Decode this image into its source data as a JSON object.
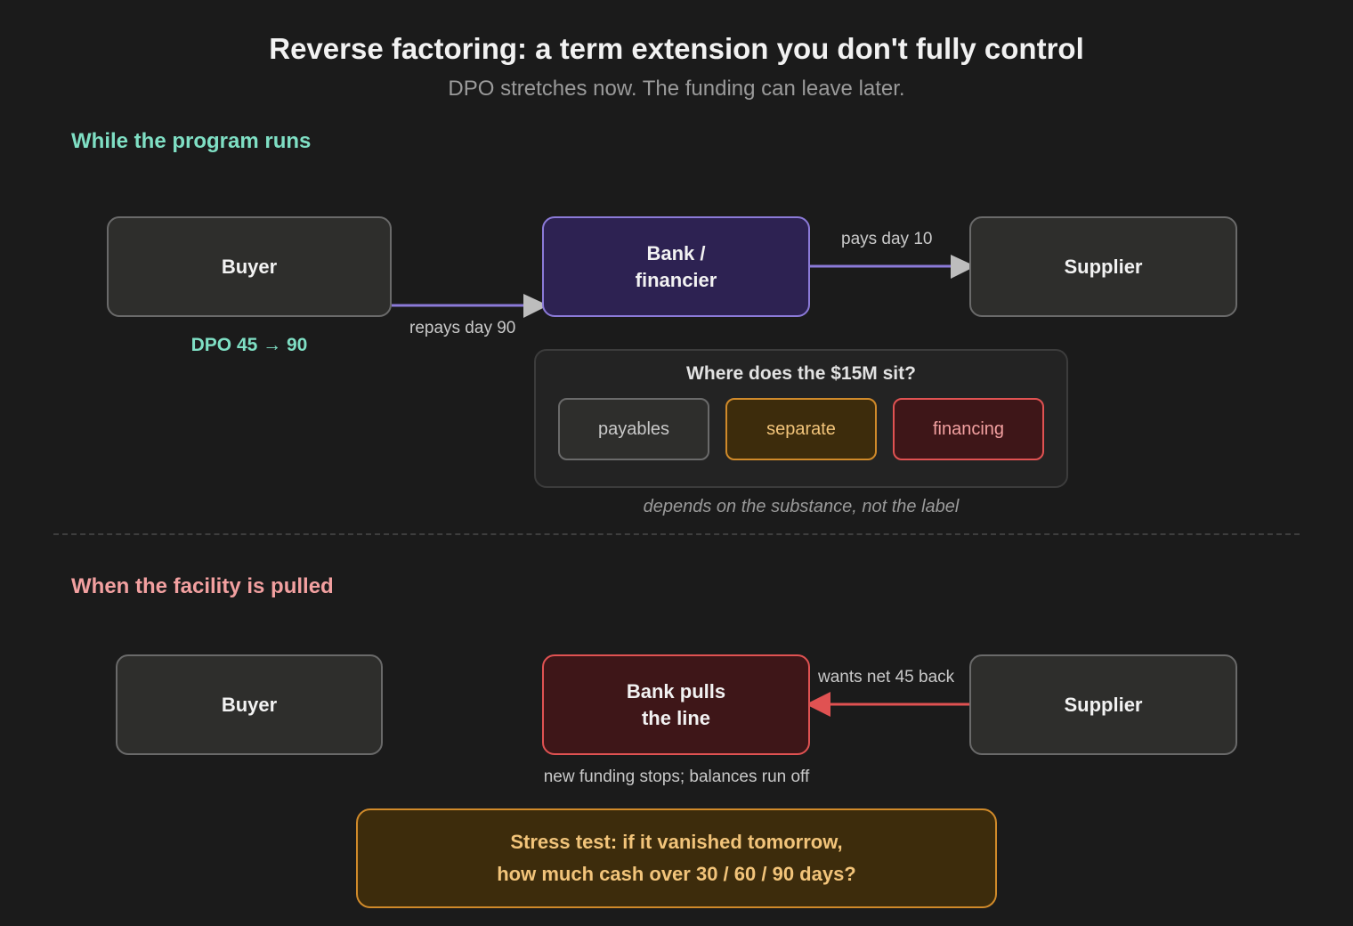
{
  "header": {
    "title": "Reverse factoring: a term extension you don't fully control",
    "subtitle": "DPO stretches now. The funding can leave later."
  },
  "running": {
    "heading": "While the program runs",
    "buyer": "Buyer",
    "bank_line1": "Bank /",
    "bank_line2": "financier",
    "supplier": "Supplier",
    "repays_label": "repays day 90",
    "pays_label": "pays day 10",
    "dpo_label": "DPO 45 → 90",
    "question": "Where does the $15M sit?",
    "options": [
      "payables",
      "separate",
      "financing"
    ],
    "note": "depends on the substance, not the label"
  },
  "pulled": {
    "heading": "When the facility is pulled",
    "buyer": "Buyer",
    "bank_line1": "Bank pulls",
    "bank_line2": "the line",
    "supplier": "Supplier",
    "wants_label": "wants net 45 back",
    "runoff_note": "new funding stops; balances run off",
    "stress_line1": "Stress test: if it vanished tomorrow,",
    "stress_line2": "how much cash over 30 / 60 / 90 days?"
  },
  "colors": {
    "accent_teal": "#7fdfc4",
    "accent_purple": "#8b7ad8",
    "accent_red": "#e05252",
    "accent_amber": "#d08a2a"
  }
}
